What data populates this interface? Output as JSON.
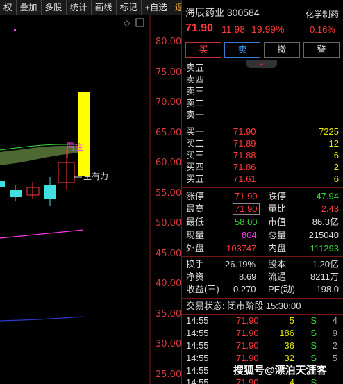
{
  "toolbar": {
    "items": [
      "权",
      "叠加",
      "多股",
      "统计",
      "画线",
      "标记",
      "+自选",
      "返回"
    ]
  },
  "chart": {
    "y_ticks": [
      "80.00",
      "75.00",
      "70.00",
      "65.00",
      "60.00",
      "55.00",
      "50.00",
      "45.00",
      "40.00",
      "35.00",
      "30.00",
      "25.00"
    ],
    "annotation_top": "有庄",
    "annotation_right": "主有力",
    "colors": {
      "up": "#ff3a3a",
      "down": "#40e0e0",
      "limitup": "#ffff00",
      "ma": "#ff3af0",
      "blue_line": "#2a3ad0"
    }
  },
  "stock": {
    "name": "海辰药业",
    "code": "300584",
    "sector": "化学制药",
    "price": "71.90",
    "change": "11.98",
    "change_pct": "19.99%",
    "sector_pct": "0.16%"
  },
  "actions": {
    "buy": "买",
    "sell": "卖",
    "cancel": "撤",
    "alert": "警"
  },
  "asks": [
    "卖五",
    "卖四",
    "卖三",
    "卖二",
    "卖一"
  ],
  "bids": [
    {
      "label": "买一",
      "price": "71.90",
      "vol": "7225"
    },
    {
      "label": "买二",
      "price": "71.89",
      "vol": "12"
    },
    {
      "label": "买三",
      "price": "71.88",
      "vol": "6"
    },
    {
      "label": "买四",
      "price": "71.86",
      "vol": "2"
    },
    {
      "label": "买五",
      "price": "71.61",
      "vol": "6"
    }
  ],
  "stats": {
    "limit_up_label": "涨停",
    "limit_up": "71.90",
    "limit_down_label": "跌停",
    "limit_down": "47.94",
    "high_label": "最高",
    "high": "71.90",
    "vol_ratio_label": "量比",
    "vol_ratio": "2.43",
    "low_label": "最低",
    "low": "58.00",
    "mcap_label": "市值",
    "mcap": "86.3亿",
    "cur_vol_label": "现量",
    "cur_vol": "804",
    "total_vol_label": "总量",
    "total_vol": "215040",
    "outer_label": "外盘",
    "outer": "103747",
    "inner_label": "内盘",
    "inner": "111293",
    "turnover_label": "换手",
    "turnover": "26.19%",
    "shares_label": "股本",
    "shares": "1.20亿",
    "net_assets_label": "净资",
    "net_assets": "8.69",
    "float_label": "流通",
    "float": "8211万",
    "eps_label": "收益(三)",
    "eps": "0.270",
    "pe_label": "PE(动)",
    "pe": "198.0"
  },
  "trade_status": "交易状态: 闭市阶段 15:30:00",
  "ticks": [
    {
      "time": "14:55",
      "price": "71.90",
      "vol": "5",
      "side": "S",
      "n": "4"
    },
    {
      "time": "14:55",
      "price": "71.90",
      "vol": "186",
      "side": "S",
      "n": "9"
    },
    {
      "time": "14:55",
      "price": "71.90",
      "vol": "36",
      "side": "S",
      "n": "2"
    },
    {
      "time": "14:55",
      "price": "71.90",
      "vol": "32",
      "side": "S",
      "n": "5"
    },
    {
      "time": "14:55",
      "price": "71.90",
      "vol": "",
      "side": "",
      "n": ""
    },
    {
      "time": "14:55",
      "price": "71.90",
      "vol": "4",
      "side": "S",
      "n": ""
    }
  ],
  "watermark": "搜狐号@漂泊天涯客"
}
